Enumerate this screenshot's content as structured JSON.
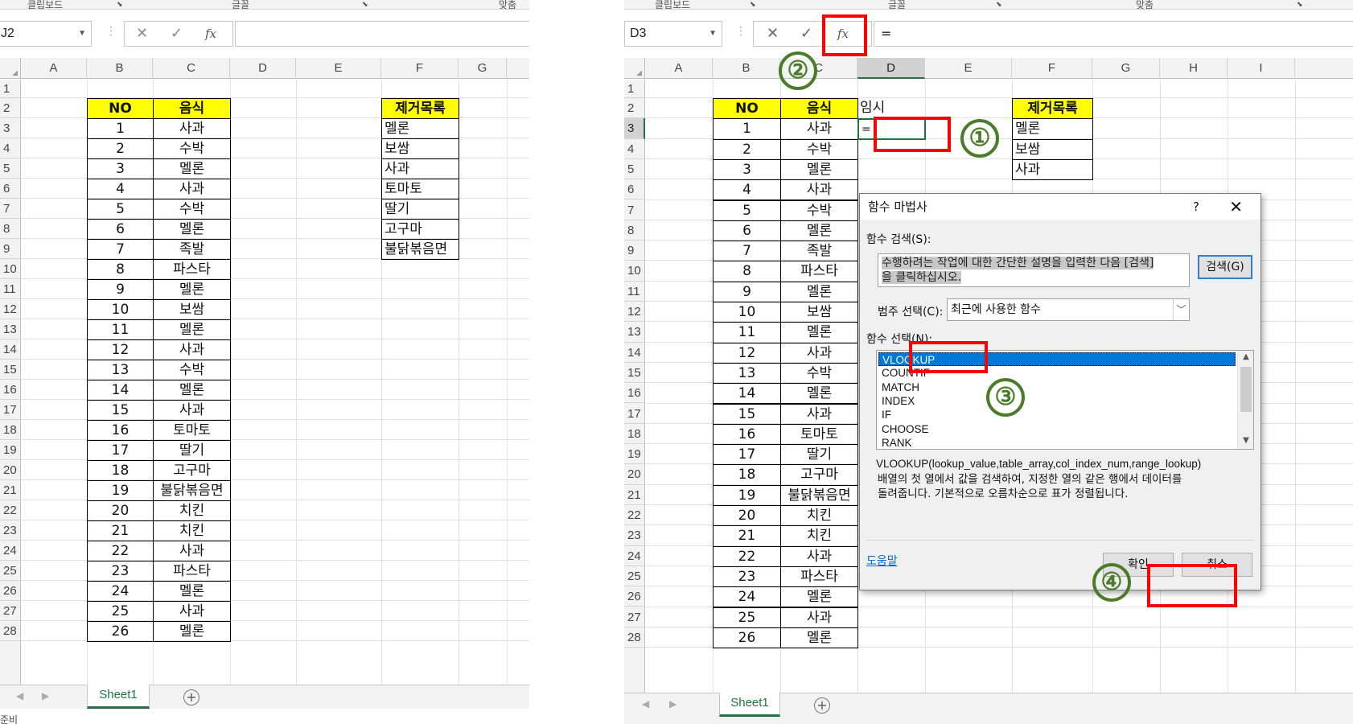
{
  "left": {
    "ribbon": {
      "clipboard": "클립보드",
      "font": "글꼴",
      "align": "맞춤"
    },
    "namebox": "J2",
    "formula": "",
    "columns": [
      "A",
      "B",
      "C",
      "D",
      "E",
      "F",
      "G"
    ],
    "rows": [
      "1",
      "2",
      "3",
      "4",
      "5",
      "6",
      "7",
      "8",
      "9",
      "10",
      "11",
      "12",
      "13",
      "14",
      "15",
      "16",
      "17",
      "18",
      "19",
      "20",
      "21",
      "22",
      "23",
      "24",
      "25",
      "26",
      "27",
      "28"
    ],
    "header_no": "NO",
    "header_food": "음식",
    "header_remove": "제거목록",
    "nos": [
      "1",
      "2",
      "3",
      "4",
      "5",
      "6",
      "7",
      "8",
      "9",
      "10",
      "11",
      "12",
      "13",
      "14",
      "15",
      "16",
      "17",
      "18",
      "19",
      "20",
      "21",
      "22",
      "23",
      "24",
      "25",
      "26"
    ],
    "foods": [
      "사과",
      "수박",
      "멜론",
      "사과",
      "수박",
      "멜론",
      "족발",
      "파스타",
      "멜론",
      "보쌈",
      "멜론",
      "사과",
      "수박",
      "멜론",
      "사과",
      "토마토",
      "딸기",
      "고구마",
      "불닭볶음면",
      "치킨",
      "치킨",
      "사과",
      "파스타",
      "멜론",
      "사과",
      "멜론"
    ],
    "remove_list": [
      "멜론",
      "보쌈",
      "사과",
      "토마토",
      "딸기",
      "고구마",
      "불닭볶음면"
    ],
    "sheet_tab": "Sheet1",
    "status": "준비"
  },
  "right": {
    "ribbon": {
      "clipboard": "클립보드",
      "font": "글꼴",
      "align": "맞춤"
    },
    "namebox": "D3",
    "formula": "=",
    "columns": [
      "A",
      "B",
      "C",
      "D",
      "E",
      "F",
      "G",
      "H",
      "I"
    ],
    "rows": [
      "1",
      "2",
      "3",
      "4",
      "5",
      "6",
      "7",
      "8",
      "9",
      "10",
      "11",
      "12",
      "13",
      "14",
      "15",
      "16",
      "17",
      "18",
      "19",
      "20",
      "21",
      "22",
      "23",
      "24",
      "25",
      "26",
      "27",
      "28"
    ],
    "header_no": "NO",
    "header_food": "음식",
    "temp_label": "임시",
    "d3_value": "=",
    "header_remove": "제거목록",
    "nos": [
      "1",
      "2",
      "3",
      "4",
      "5",
      "6",
      "7",
      "8",
      "9",
      "10",
      "11",
      "12",
      "13",
      "14",
      "15",
      "16",
      "17",
      "18",
      "19",
      "20",
      "21",
      "22",
      "23",
      "24",
      "25",
      "26"
    ],
    "foods": [
      "사과",
      "수박",
      "멜론",
      "사과",
      "수박",
      "멜론",
      "족발",
      "파스타",
      "멜론",
      "보쌈",
      "멜론",
      "사과",
      "수박",
      "멜론",
      "사과",
      "토마토",
      "딸기",
      "고구마",
      "불닭볶음면",
      "치킨",
      "치킨",
      "사과",
      "파스타",
      "멜론",
      "사과",
      "멜론"
    ],
    "remove_list_visible": [
      "멜론",
      "보쌈",
      "사과"
    ],
    "sheet_tab": "Sheet1"
  },
  "dialog": {
    "title": "함수 마법사",
    "help": "?",
    "close": "✕",
    "search_label": "함수 검색(S):",
    "search_text_1": "수행하려는 작업에 대한 간단한 설명을 입력한 다음 [검색]",
    "search_text_2": "을 클릭하십시오.",
    "search_button": "검색(G)",
    "category_label": "범주 선택(C):",
    "category_value": "최근에 사용한 함수",
    "function_label": "함수 선택(N):",
    "functions": [
      "VLOOKUP",
      "COUNTIF",
      "MATCH",
      "INDEX",
      "IF",
      "CHOOSE",
      "RANK"
    ],
    "syntax": "VLOOKUP(lookup_value,table_array,col_index_num,range_lookup)",
    "description_1": "배열의 첫 열에서 값을 검색하여, 지정한 열의 같은 행에서 데이터를",
    "description_2": "돌려줍니다. 기본적으로 오름차순으로 표가 정렬됩니다.",
    "help_link": "도움말",
    "ok": "확인",
    "cancel": "취소"
  },
  "steps": [
    "①",
    "②",
    "③",
    "④"
  ],
  "colors": {
    "accent_green": "#217346",
    "highlight_red": "#ff0000",
    "step_green": "#4a7c2a",
    "header_yellow": "#ffff00",
    "select_blue": "#0078d7"
  }
}
